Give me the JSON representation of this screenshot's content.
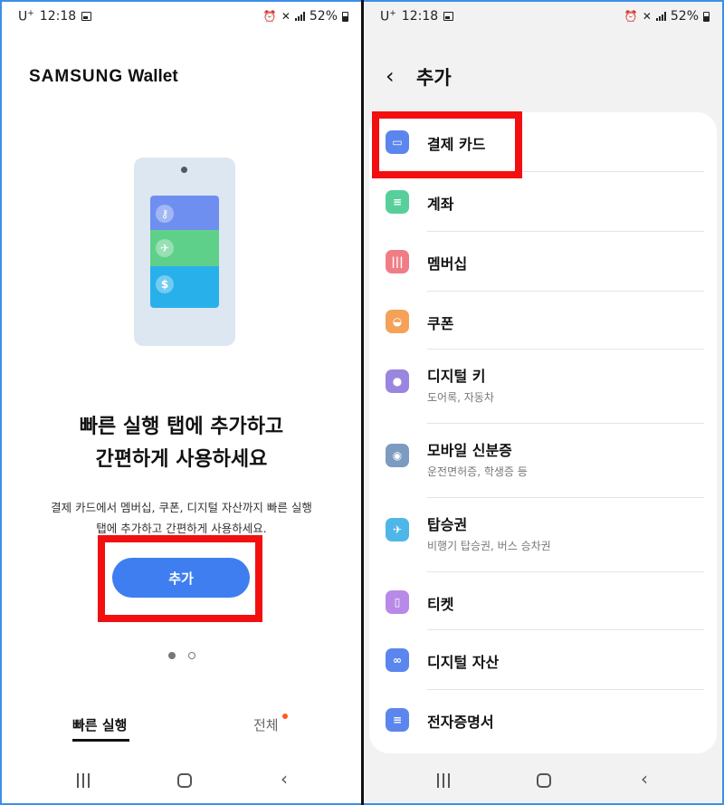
{
  "left": {
    "status": {
      "carrier": "U",
      "carrier_sup": "+",
      "time": "12:18",
      "battery": "52%"
    },
    "brand": {
      "samsung": "SAMSUNG",
      "wallet": "Wallet"
    },
    "headline_line1": "빠른 실행 탭에 추가하고",
    "headline_line2": "간편하게 사용하세요",
    "desc_line1": "결제 카드에서 멤버십, 쿠폰, 디지털 자산까지 빠른 실행",
    "desc_line2": "탭에 추가하고 간편하게 사용하세요.",
    "add_button": "추가",
    "tabs": {
      "quick": "빠른 실행",
      "all": "전체"
    }
  },
  "right": {
    "status": {
      "carrier": "U",
      "carrier_sup": "+",
      "time": "12:18",
      "battery": "52%"
    },
    "title": "추가",
    "items": [
      {
        "title": "결제 카드",
        "subtitle": "",
        "icon": "card-icon",
        "color": "#5b86ee"
      },
      {
        "title": "계좌",
        "subtitle": "",
        "icon": "account-icon",
        "color": "#58cf9a"
      },
      {
        "title": "멤버십",
        "subtitle": "",
        "icon": "membership-icon",
        "color": "#f07d86"
      },
      {
        "title": "쿠폰",
        "subtitle": "",
        "icon": "coupon-icon",
        "color": "#f4a25a"
      },
      {
        "title": "디지털 키",
        "subtitle": "도어록, 자동차",
        "icon": "key-icon",
        "color": "#9a86df"
      },
      {
        "title": "모바일 신분증",
        "subtitle": "운전면허증, 학생증 등",
        "icon": "id-card-icon",
        "color": "#7c9bc0"
      },
      {
        "title": "탑승권",
        "subtitle": "비행기 탑승권, 버스 승차권",
        "icon": "boarding-pass-icon",
        "color": "#4fb6e8"
      },
      {
        "title": "티켓",
        "subtitle": "",
        "icon": "ticket-icon",
        "color": "#b88ae8"
      },
      {
        "title": "디지털 자산",
        "subtitle": "",
        "icon": "digital-asset-icon",
        "color": "#5b86ee"
      },
      {
        "title": "전자증명서",
        "subtitle": "",
        "icon": "certificate-icon",
        "color": "#5b86ee"
      }
    ]
  }
}
